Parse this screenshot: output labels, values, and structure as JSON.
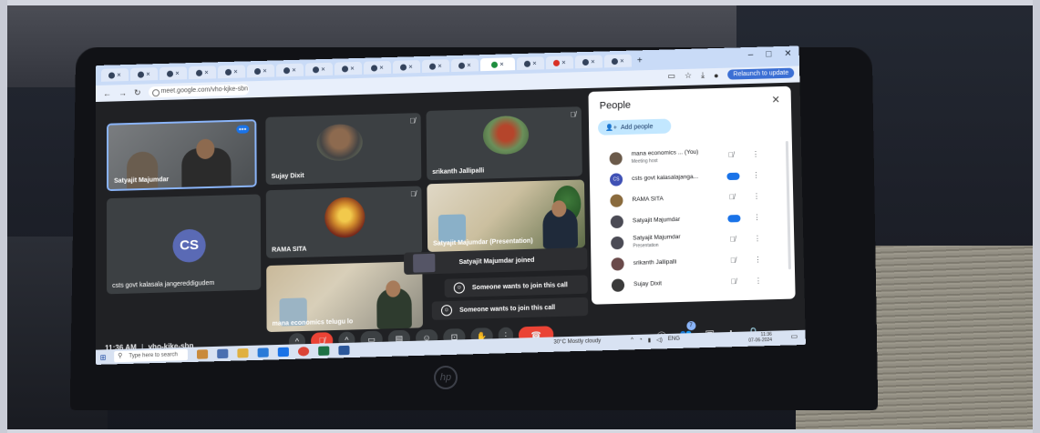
{
  "browser": {
    "url": "meet.google.com/vho-kjke-sbn",
    "relaunch_label": "Relaunch to update",
    "window_controls": [
      "–",
      "□",
      "✕"
    ],
    "new_tab": "+"
  },
  "tiles": [
    {
      "name": "Satyajit Majumdar",
      "kind": "video"
    },
    {
      "name": "Sujay Dixit",
      "kind": "avatar"
    },
    {
      "name": "srikanth Jallipalli",
      "kind": "avatar"
    },
    {
      "name": "csts govt kalasala jangereddigudem",
      "kind": "initials",
      "initials": "CS"
    },
    {
      "name": "RAMA SITA",
      "kind": "avatar"
    },
    {
      "name": "Satyajit Majumdar (Presentation)",
      "kind": "video"
    },
    {
      "name": "mana economics telugu lo",
      "kind": "video"
    }
  ],
  "toasts": [
    {
      "text": "Satyajit Majumdar joined"
    },
    {
      "text": "Someone wants to join this call"
    },
    {
      "text": "Someone wants to join this call"
    }
  ],
  "bottom_bar": {
    "time": "11:36 AM",
    "separator": "|",
    "meeting_code": "vho-kjke-sbn",
    "people_count": "7"
  },
  "people_panel": {
    "title": "People",
    "add_people_label": "Add people",
    "participants": [
      {
        "name": "mana economics ... (You)",
        "sub": "Meeting host",
        "color": "#6b5a4a"
      },
      {
        "name": "csts govt kalasalajanga...",
        "sub": "",
        "color": "#3f51b5",
        "initials": "CS"
      },
      {
        "name": "RAMA SITA",
        "sub": "",
        "color": "#8a6b3d"
      },
      {
        "name": "Satyajit Majumdar",
        "sub": "",
        "color": "#4b4b55"
      },
      {
        "name": "Satyajit Majumdar",
        "sub": "Presentation",
        "color": "#4b4b55"
      },
      {
        "name": "srikanth Jallipalli",
        "sub": "",
        "color": "#6a4a4a"
      },
      {
        "name": "Sujay Dixit",
        "sub": "",
        "color": "#3b3b3b"
      }
    ]
  },
  "taskbar": {
    "search_placeholder": "Type here to search",
    "weather": "30°C  Mostly cloudy",
    "language": "ENG",
    "time": "11:36",
    "date": "07-06-2024"
  },
  "device": {
    "brand": "hp"
  },
  "colors": {
    "meet_bg": "#202124",
    "tile_bg": "#3c4043",
    "end_call": "#ea4335",
    "accent": "#1a73e8"
  }
}
